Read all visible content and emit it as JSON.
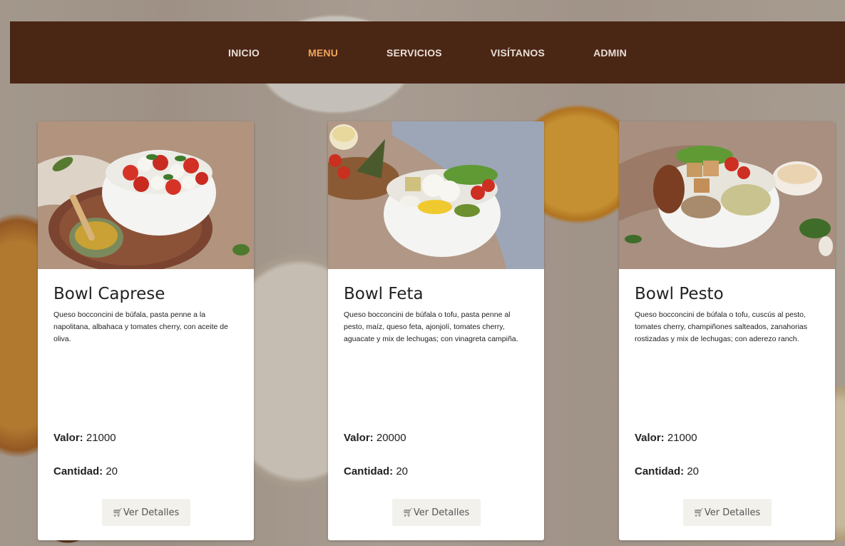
{
  "nav": {
    "items": [
      {
        "label": "INICIO",
        "active": false
      },
      {
        "label": "MENU",
        "active": true
      },
      {
        "label": "SERVICIOS",
        "active": false
      },
      {
        "label": "VISÍTANOS",
        "active": false
      },
      {
        "label": "ADMIN",
        "active": false
      }
    ]
  },
  "labels": {
    "valor": "Valor:",
    "cantidad": "Cantidad:",
    "button": "Ver Detalles",
    "button_icon": "cart-icon"
  },
  "products": [
    {
      "title": "Bowl Caprese",
      "description": "Queso bocconcini de búfala, pasta penne a la napolitana, albahaca y tomates cherry, con aceite de oliva.",
      "valor": "21000",
      "cantidad": "20"
    },
    {
      "title": "Bowl Feta",
      "description": "Queso bocconcini de búfala o tofu, pasta penne al pesto, maíz, queso feta, ajonjolí, tomates cherry, aguacate y mix de lechugas; con vinagreta campiña.",
      "valor": "20000",
      "cantidad": "20"
    },
    {
      "title": "Bowl Pesto",
      "description": "Queso bocconcini de búfala o tofu, cuscús al pesto, tomates cherry, champiñones salteados, zanahorias rostizadas y mix de lechugas; con aderezo ranch.",
      "valor": "21000",
      "cantidad": "20"
    }
  ],
  "colors": {
    "navbar": "#4a2615",
    "nav_active": "#f0a55b",
    "card_bg": "#ffffff",
    "button_bg": "#f2f1ec"
  }
}
